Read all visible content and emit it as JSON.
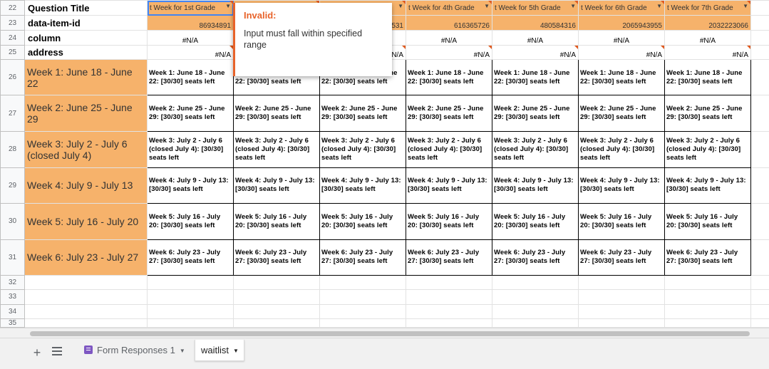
{
  "row_numbers": [
    "22",
    "23",
    "24",
    "25",
    "26",
    "27",
    "28",
    "29",
    "30",
    "31",
    "32",
    "33",
    "34",
    "35"
  ],
  "labels": {
    "question_title": "Question Title",
    "data_item_id": "data-item-id",
    "column": "column",
    "address": "address"
  },
  "headers": [
    "t Week for 1st Grade",
    "",
    "",
    "t Week for 4th Grade",
    "t Week for 5th Grade",
    "t Week for 6th Grade",
    "t Week for 7th Grade"
  ],
  "ids": [
    "86934891",
    "",
    "531",
    "616365726",
    "480584316",
    "2065943955",
    "2032223066"
  ],
  "na": "#N/A",
  "na_partial": "N/A",
  "weeks": [
    {
      "label": "Week 1: June 18 - June 22",
      "cell": "Week 1: June 18 - June 22: [30/30] seats left"
    },
    {
      "label": "Week 2: June 25 - June 29",
      "cell": "Week 2: June 25 - June 29: [30/30] seats left"
    },
    {
      "label": "Week 3: July 2 - July 6 (closed July 4)",
      "cell": "Week 3: July 2 - July 6 (closed July 4): [30/30] seats left"
    },
    {
      "label": "Week 4: July 9 - July 13",
      "cell": "Week 4: July 9 - July 13: [30/30] seats left"
    },
    {
      "label": "Week 5: July 16 - July 20",
      "cell": "Week 5: July 16 - July 20: [30/30] seats left"
    },
    {
      "label": "Week 6: July 23 - July 27",
      "cell": "Week 6: July 23 - July 27: [30/30] seats left"
    }
  ],
  "tooltip": {
    "title": "Invalid:",
    "message": "Input must fall within specified range"
  },
  "sheet_tabs": {
    "add": "+",
    "form_responses": "Form Responses 1",
    "waitlist": "waitlist"
  },
  "colors": {
    "header_fill": "#f6b26b",
    "invalid_accent": "#e8632a"
  }
}
